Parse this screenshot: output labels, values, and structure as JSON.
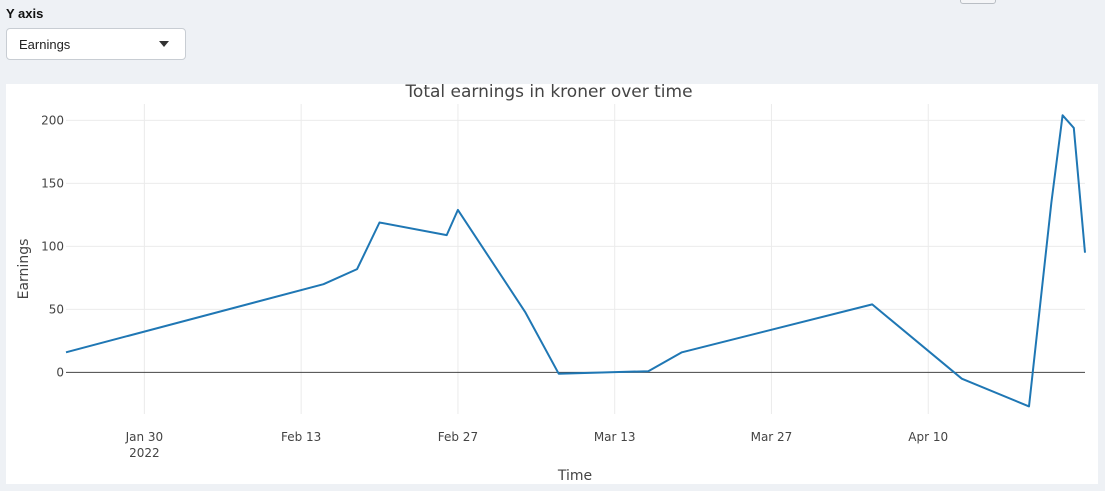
{
  "controls": {
    "yaxis_label": "Y axis",
    "yaxis_selected": "Earnings"
  },
  "chart_data": {
    "type": "line",
    "title": "Total earnings in kroner over time",
    "xlabel": "Time",
    "ylabel": "Earnings",
    "x_ticks": [
      {
        "date": "2022-01-30",
        "label": "Jan 30",
        "sublabel": "2022"
      },
      {
        "date": "2022-02-13",
        "label": "Feb 13",
        "sublabel": ""
      },
      {
        "date": "2022-02-27",
        "label": "Feb 27",
        "sublabel": ""
      },
      {
        "date": "2022-03-13",
        "label": "Mar 13",
        "sublabel": ""
      },
      {
        "date": "2022-03-27",
        "label": "Mar 27",
        "sublabel": ""
      },
      {
        "date": "2022-04-10",
        "label": "Apr 10",
        "sublabel": ""
      }
    ],
    "y_ticks": [
      0,
      50,
      100,
      150,
      200
    ],
    "xlim": [
      "2022-01-23",
      "2022-04-24"
    ],
    "ylim": [
      -33,
      213
    ],
    "grid": true,
    "zero_line": true,
    "line_color": "#1f77b4",
    "series": [
      {
        "x": [
          "2022-01-23",
          "2022-02-15",
          "2022-02-18",
          "2022-02-20",
          "2022-02-26",
          "2022-02-27",
          "2022-03-05",
          "2022-03-08",
          "2022-03-16",
          "2022-03-19",
          "2022-04-05",
          "2022-04-13",
          "2022-04-19",
          "2022-04-21",
          "2022-04-22",
          "2022-04-23",
          "2022-04-24"
        ],
        "y": [
          16,
          70,
          82,
          119,
          109,
          129,
          48,
          -1,
          1,
          16,
          54,
          -5,
          -27,
          135,
          204,
          194,
          95
        ]
      }
    ]
  }
}
